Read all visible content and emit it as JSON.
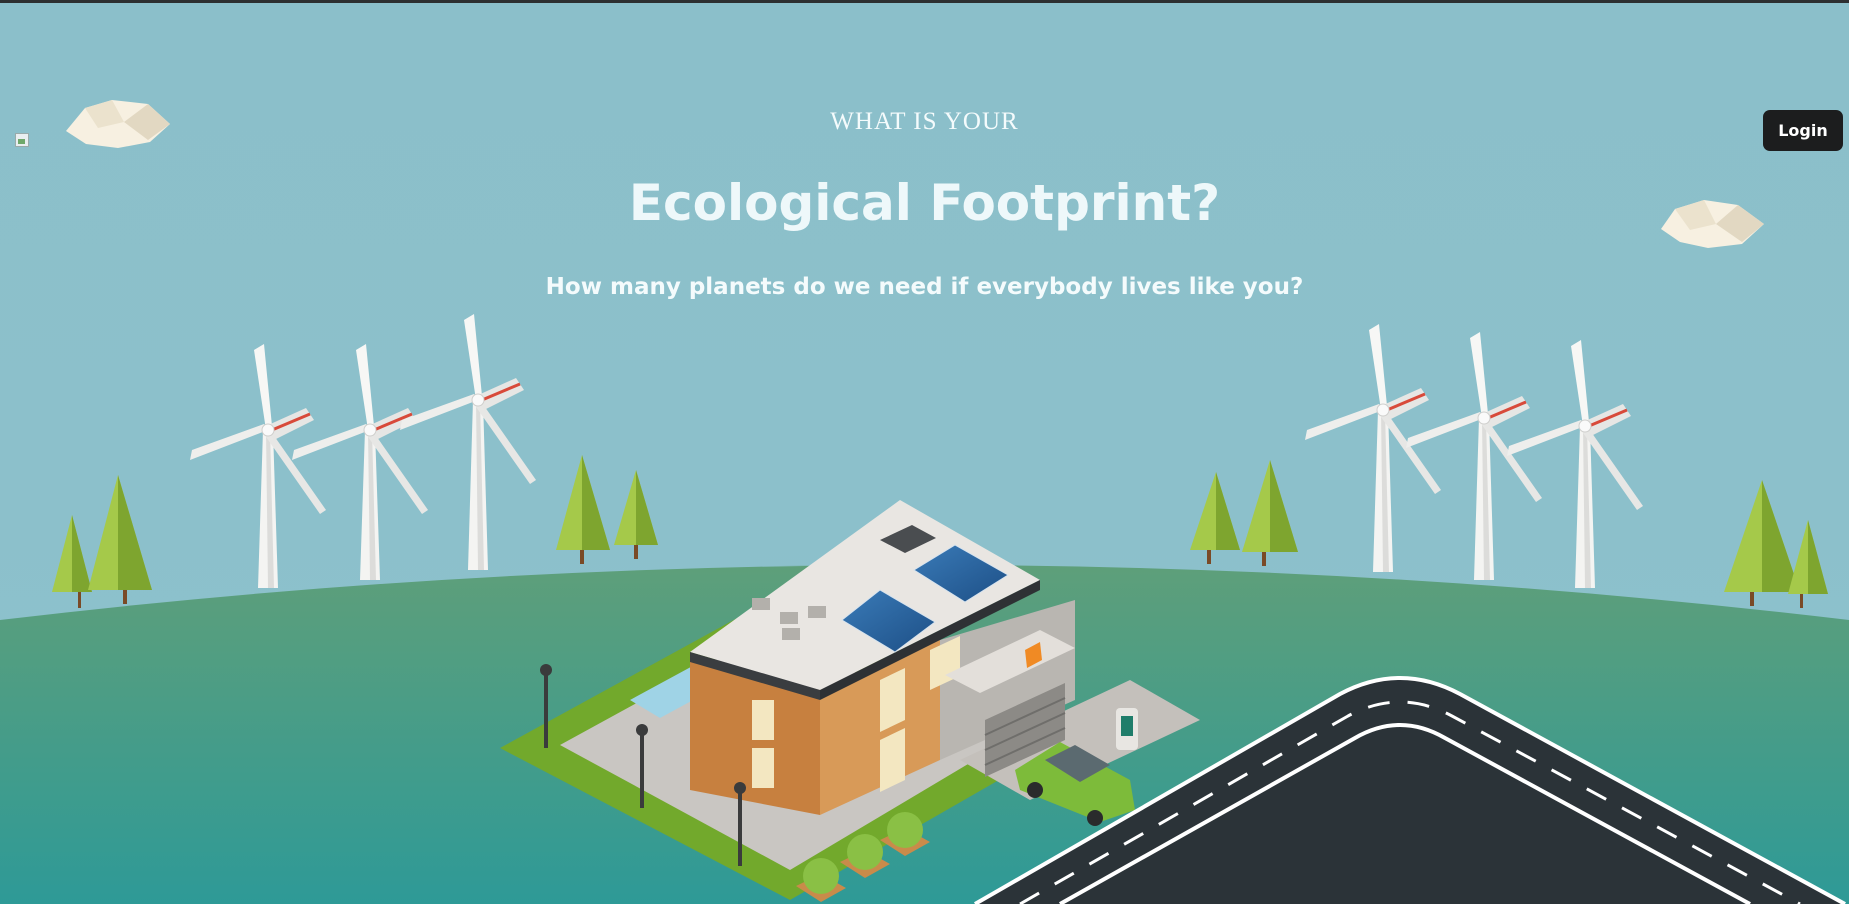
{
  "hero": {
    "pre_title": "WHAT IS YOUR",
    "title": "Ecological Footprint?",
    "subtitle": "How many planets do we need if everybody lives like you?"
  },
  "header": {
    "login_label": "Login"
  },
  "colors": {
    "sky": "#8cc0cb",
    "ground_top": "#5e9f7a",
    "ground_bottom": "#2f9a96",
    "button_bg": "#1c1d1e",
    "text": "#eef8fa"
  }
}
